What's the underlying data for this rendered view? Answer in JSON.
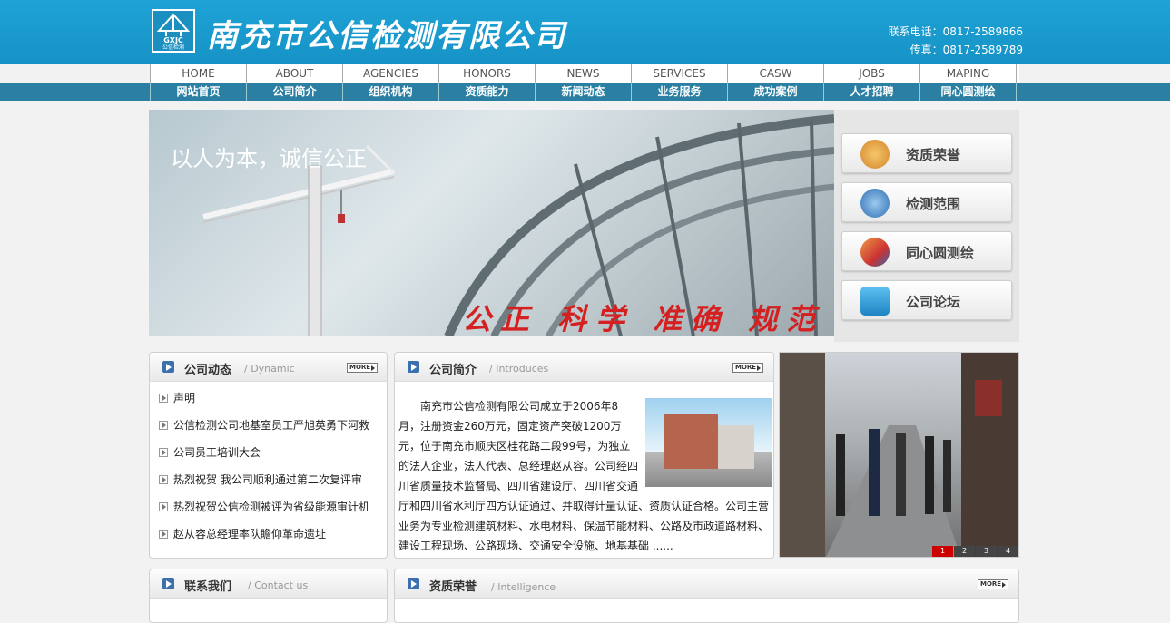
{
  "header": {
    "company_name": "南充市公信检测有限公司",
    "logo_text": "GXJC",
    "logo_subtext": "公信检测",
    "phone": "联系电话：0817-2589866",
    "fax": "传真：0817-2589789"
  },
  "nav": {
    "en": [
      "HOME",
      "ABOUT",
      "AGENCIES",
      "HONORS",
      "NEWS",
      "SERVICES",
      "CASW",
      "JOBS",
      "MAPING"
    ],
    "cn": [
      "网站首页",
      "公司简介",
      "组织机构",
      "资质能力",
      "新闻动态",
      "业务服务",
      "成功案例",
      "人才招聘",
      "同心圆测绘"
    ]
  },
  "banner": {
    "slogan": "以人为本，诚信公正",
    "motto": "公正 科学 准确 规范"
  },
  "quick_links": [
    {
      "label": "资质荣誉",
      "icon": "medal-icon",
      "color": "#e8a23b"
    },
    {
      "label": "检测范围",
      "icon": "footprint-icon",
      "color": "#3f86c7"
    },
    {
      "label": "同心圆测绘",
      "icon": "survey-icon",
      "color": "#c43a3a"
    },
    {
      "label": "公司论坛",
      "icon": "forum-icon",
      "color": "#2f9ad3"
    }
  ],
  "dynamic": {
    "title": "公司动态",
    "subtitle": "/ Dynamic",
    "more": "MORE",
    "items": [
      "声明",
      "公信检测公司地基室员工严旭英勇下河救",
      "公司员工培训大会",
      "热烈祝贺 我公司顺利通过第二次复评审",
      "热烈祝贺公信检测被评为省级能源审计机",
      "赵从容总经理率队瞻仰革命遗址"
    ]
  },
  "intro": {
    "title": "公司简介",
    "subtitle": "/ Introduces",
    "more": "MORE",
    "text": "南充市公信检测有限公司成立于2006年8月，注册资金260万元，固定资产突破1200万元，位于南充市顺庆区桂花路二段99号，为独立的法人企业，法人代表、总经理赵从容。公司经四川省质量技术监督局、四川省建设厅、四川省交通厅和四川省水利厅四方认证通过、并取得计量认证、资质认证合格。公司主营业务为专业检测建筑材料、水电材料、保温节能材料、公路及市政道路材料、建设工程现场、公路现场、交通安全设施、地基基础 ......"
  },
  "photo": {
    "pages": [
      "1",
      "2",
      "3",
      "4"
    ],
    "active": "1"
  },
  "contact": {
    "title": "联系我们",
    "subtitle": "/ Contact us"
  },
  "qualification": {
    "title": "资质荣誉",
    "subtitle": "/ Intelligence",
    "more": "MORE"
  },
  "colors": {
    "header": "#1ea3d6",
    "navbar": "#2a7fa3",
    "motto": "#d42020"
  }
}
